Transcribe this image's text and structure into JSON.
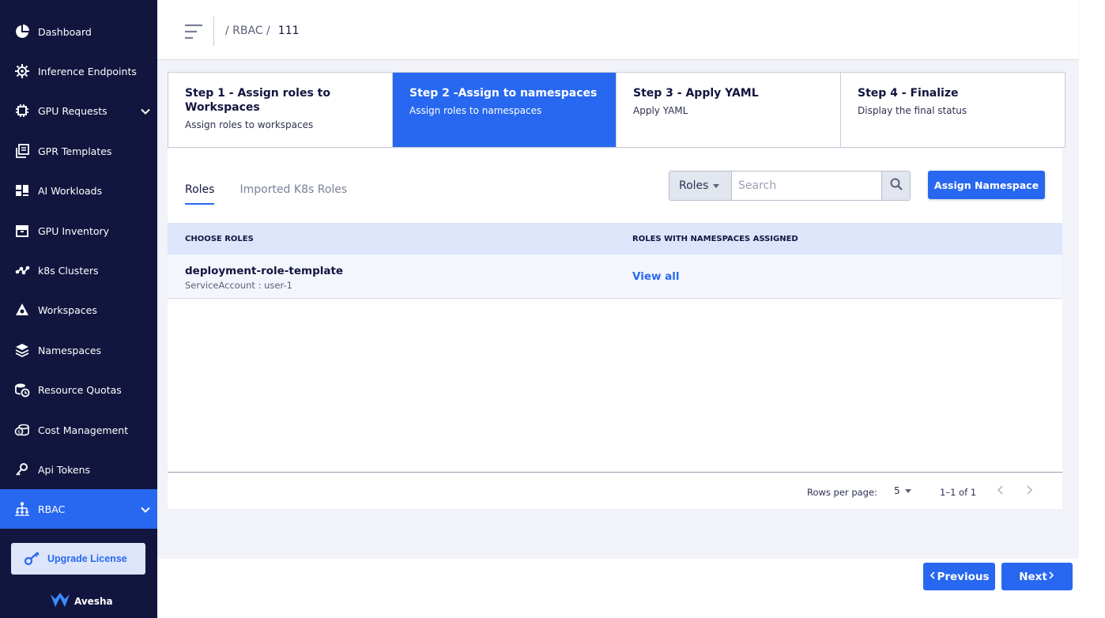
{
  "sidebar": {
    "items": [
      {
        "label": "Dashboard",
        "icon": "pie-chart-icon"
      },
      {
        "label": "Inference Endpoints",
        "icon": "chip-gear-icon"
      },
      {
        "label": "GPU Requests",
        "icon": "chip-icon"
      },
      {
        "label": "GPR Templates",
        "icon": "template-icon"
      },
      {
        "label": "AI Workloads",
        "icon": "dashboard-grid-icon"
      },
      {
        "label": "GPU Inventory",
        "icon": "archive-icon"
      },
      {
        "label": "k8s Clusters",
        "icon": "cluster-nodes-icon"
      },
      {
        "label": "Workspaces",
        "icon": "workspace-triangle-icon"
      },
      {
        "label": "Namespaces",
        "icon": "layers-icon"
      },
      {
        "label": "Resource Quotas",
        "icon": "quota-clock-icon"
      },
      {
        "label": "Cost Management",
        "icon": "coins-icon"
      },
      {
        "label": "Api Tokens",
        "icon": "key-icon"
      },
      {
        "label": "RBAC",
        "icon": "hierarchy-icon"
      }
    ],
    "upgrade_label": "Upgrade License",
    "brand": "Avesha"
  },
  "header": {
    "breadcrumb_path": "/ RBAC /",
    "breadcrumb_current": "111"
  },
  "stepper": {
    "steps": [
      {
        "title": "Step 1 - Assign roles to Workspaces",
        "desc": "Assign roles to workspaces"
      },
      {
        "title": "Step 2 -Assign to namespaces",
        "desc": "Assign roles to namespaces"
      },
      {
        "title": "Step 3 - Apply YAML",
        "desc": "Apply YAML"
      },
      {
        "title": "Step 4 - Finalize",
        "desc": "Display the final status"
      }
    ]
  },
  "tabs": [
    {
      "label": "Roles"
    },
    {
      "label": "Imported K8s Roles"
    }
  ],
  "filter": {
    "select_value": "Roles",
    "search_placeholder": "Search"
  },
  "assign_button": "Assign Namespace",
  "table": {
    "columns": [
      "CHOOSE ROLES",
      "ROLES WITH NAMESPACES ASSIGNED"
    ],
    "rows": [
      {
        "name": "deployment-role-template",
        "sub": "ServiceAccount : user-1",
        "action": "View all"
      }
    ]
  },
  "pagination": {
    "rows_per_page_label": "Rows per page:",
    "rows_per_page": "5",
    "range": "1–1 of 1"
  },
  "nav_buttons": {
    "previous": "Previous",
    "next": "Next"
  },
  "colors": {
    "sidebar_bg": "#12153e",
    "accent": "#2868f0",
    "table_header_bg": "#dde5fb"
  }
}
